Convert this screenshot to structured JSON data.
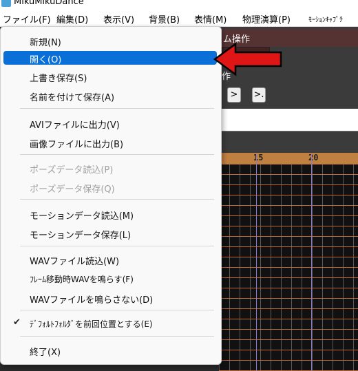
{
  "window": {
    "title": "MikuMikuDance"
  },
  "menubar": {
    "items": [
      "ファイル(F)",
      "編集(D)",
      "表示(V)",
      "背景(B)",
      "表情(M)",
      "物理演算(P)",
      "ﾓｰｼｮﾝｷｬﾌﾟﾁ"
    ]
  },
  "background": {
    "panel_header": "ム操作",
    "op_label": "作",
    "nav_buttons": [
      ">",
      ">."
    ],
    "timeline_ticks": [
      "15",
      "20"
    ]
  },
  "file_menu": {
    "items": [
      {
        "label": "新規(N)",
        "state": "normal"
      },
      {
        "label": "開く(O)",
        "state": "highlighted"
      },
      {
        "label": "上書き保存(S)",
        "state": "normal"
      },
      {
        "label": "名前を付けて保存(A)",
        "state": "normal"
      },
      {
        "label": "AVIファイルに出力(V)",
        "state": "normal"
      },
      {
        "label": "画像ファイルに出力(B)",
        "state": "normal"
      },
      {
        "label": "ポーズデータ読込(P)",
        "state": "disabled"
      },
      {
        "label": "ポーズデータ保存(Q)",
        "state": "disabled"
      },
      {
        "label": "モーションデータ読込(M)",
        "state": "normal"
      },
      {
        "label": "モーションデータ保存(L)",
        "state": "normal"
      },
      {
        "label": "WAVファイル読込(W)",
        "state": "normal"
      },
      {
        "label": "ﾌﾚｰﾑ移動時WAVを鳴らす(F)",
        "state": "normal"
      },
      {
        "label": "WAVファイルを鳴らさない(D)",
        "state": "normal"
      },
      {
        "label": "ﾃﾞﾌｫﾙﾄﾌｫﾙﾀﾞを前回位置とする(E)",
        "state": "checked"
      },
      {
        "label": "終了(X)",
        "state": "normal"
      }
    ],
    "check_glyph": "✔"
  },
  "colors": {
    "highlight": "#0a6fd6",
    "arrow": "#e01515"
  }
}
